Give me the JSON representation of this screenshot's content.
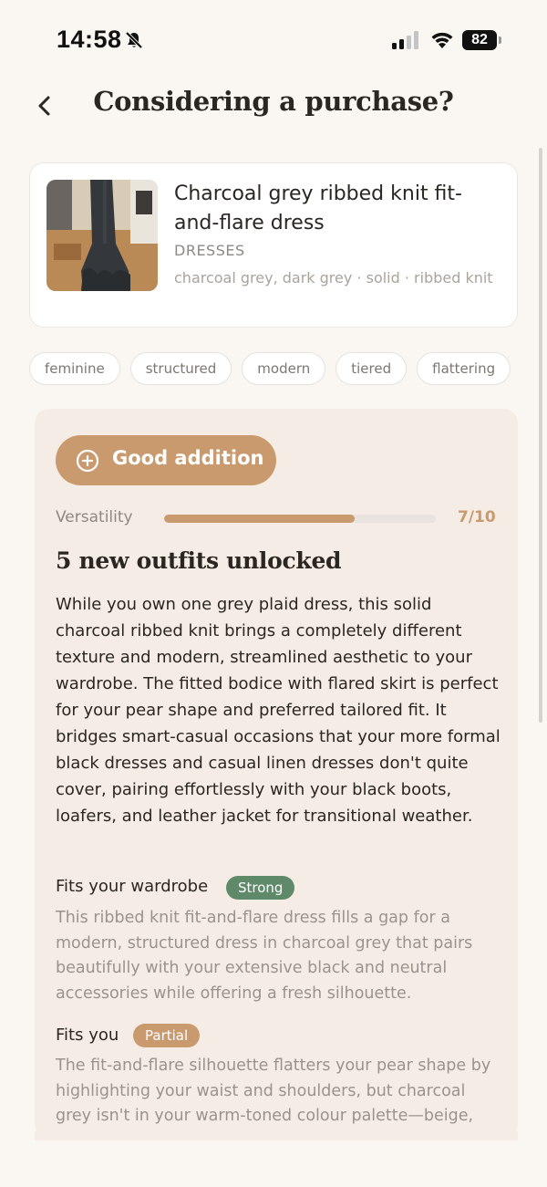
{
  "status_bar": {
    "time": "14:58",
    "battery": "82"
  },
  "header": {
    "title": "Considering a purchase?"
  },
  "product": {
    "name": "Charcoal grey ribbed knit fit-and-flare dress",
    "category": "DRESSES",
    "attributes": "charcoal grey, dark grey · solid · ribbed knit"
  },
  "tags": [
    "feminine",
    "structured",
    "modern",
    "tiered",
    "flattering"
  ],
  "analysis": {
    "verdict": "Good addition",
    "versatility_label": "Versatility",
    "versatility_score": "7/10",
    "versatility_fraction": 0.7,
    "outfits_heading": "5 new outfits unlocked",
    "summary": "While you own one grey plaid dress, this solid charcoal ribbed knit brings a completely different texture and modern, streamlined aesthetic to your wardrobe. The fitted bodice with flared skirt is perfect for your pear shape and preferred tailored fit. It bridges smart-casual occasions that your more formal black dresses and casual linen dresses don't quite cover, pairing effortlessly with your black boots, loafers, and leather jacket for transitional weather.",
    "sections": [
      {
        "title": "Fits your wardrobe",
        "badge": "Strong",
        "body": "This ribbed knit fit-and-flare dress fills a gap for a modern, structured dress in charcoal grey that pairs beautifully with your extensive black and neutral accessories while offering a fresh silhouette."
      },
      {
        "title": "Fits you",
        "badge": "Partial",
        "body": "The fit-and-flare silhouette flatters your pear shape by highlighting your waist and shoulders, but charcoal grey isn't in your warm-toned colour palette—beige, cream, camel, or blush would suit your warm"
      }
    ]
  },
  "colors": {
    "accent": "#c99a6e",
    "strong_badge": "#5e8a6a",
    "background": "#faf7f2",
    "panel": "#f5ede5"
  },
  "icons": [
    "mute-bell-icon",
    "signal-icon",
    "wifi-icon",
    "battery-icon",
    "back-chevron-icon",
    "plus-circle-icon"
  ]
}
